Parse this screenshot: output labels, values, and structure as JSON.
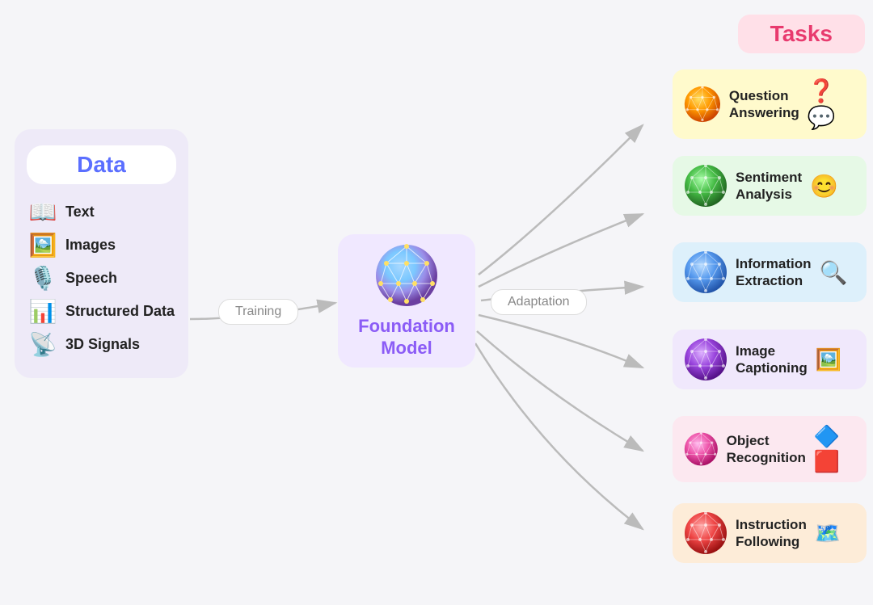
{
  "data_section": {
    "title": "Data",
    "items": [
      {
        "label": "Text",
        "icon": "📖"
      },
      {
        "label": "Images",
        "icon": "🖼️"
      },
      {
        "label": "Speech",
        "icon": "🎙️"
      },
      {
        "label": "Structured Data",
        "icon": "📊"
      },
      {
        "label": "3D Signals",
        "icon": "📡"
      }
    ]
  },
  "training": {
    "label": "Training"
  },
  "foundation": {
    "title": "Foundation\nModel"
  },
  "adaptation": {
    "label": "Adaptation"
  },
  "tasks": {
    "title": "Tasks",
    "items": [
      {
        "label": "Question\nAnswering",
        "icon": "❓💬",
        "color": "card-yellow"
      },
      {
        "label": "Sentiment\nAnalysis",
        "icon": "😊",
        "color": "card-green"
      },
      {
        "label": "Information\nExtraction",
        "icon": "🔍",
        "color": "card-blue"
      },
      {
        "label": "Image\nCaptioning",
        "icon": "🖼️",
        "color": "card-purple"
      },
      {
        "label": "Object\nRecognition",
        "icon": "🔷",
        "color": "card-pink"
      },
      {
        "label": "Instruction\nFollowing",
        "icon": "🗺️",
        "color": "card-peach"
      }
    ]
  }
}
